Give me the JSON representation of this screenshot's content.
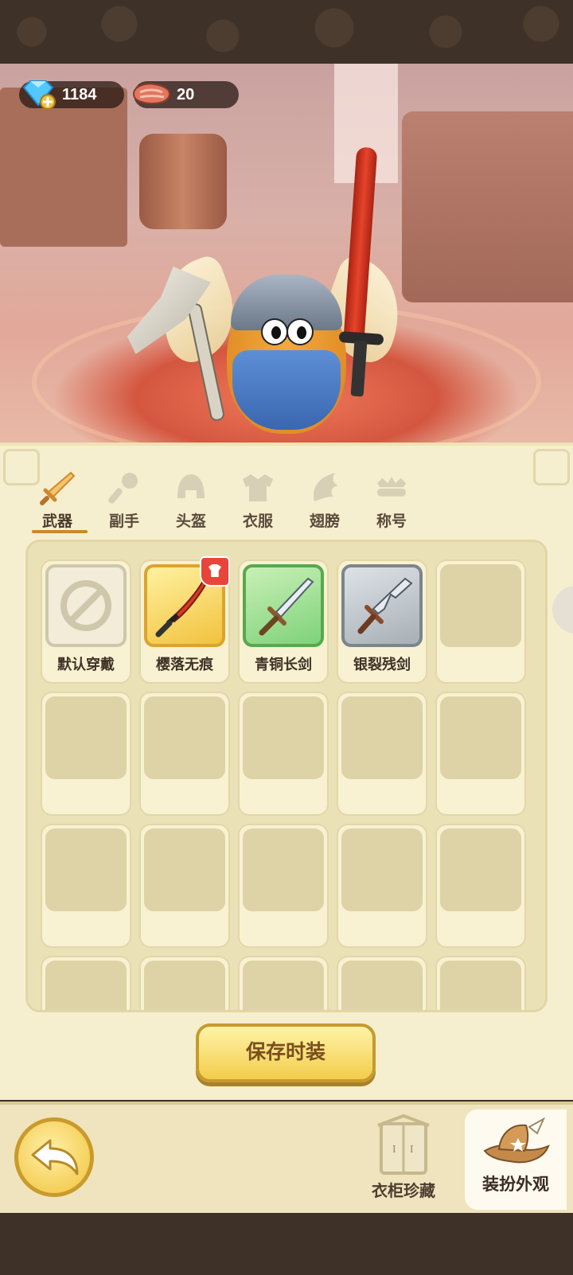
{
  "currency": {
    "gems": "1184",
    "meat": "20",
    "gem_icon": "gem-plus-icon",
    "meat_icon": "meat-icon"
  },
  "tabs": [
    {
      "label": "武器",
      "icon": "sword-icon",
      "active": true
    },
    {
      "label": "副手",
      "icon": "mace-icon",
      "active": false
    },
    {
      "label": "头盔",
      "icon": "helmet-icon",
      "active": false
    },
    {
      "label": "衣服",
      "icon": "armor-icon",
      "active": false
    },
    {
      "label": "翅膀",
      "icon": "wing-icon",
      "active": false
    },
    {
      "label": "称号",
      "icon": "crown-icon",
      "active": false
    }
  ],
  "items": [
    {
      "name": "默认穿戴",
      "rarity": "default"
    },
    {
      "name": "樱落无痕",
      "rarity": "gold",
      "badge": "outfit-badge-icon"
    },
    {
      "name": "青铜长剑",
      "rarity": "green"
    },
    {
      "name": "银裂残剑",
      "rarity": "silver"
    }
  ],
  "buttons": {
    "save": "保存时装",
    "wardrobe": "衣柜珍藏",
    "dress_up": "装扮外观"
  },
  "colors": {
    "accent_gold": "#f3cd4b",
    "panel_bg": "#f6efcf",
    "tab_underline": "#c9892a",
    "rarity_gold": "#dca42d",
    "rarity_green": "#58a84e",
    "rarity_silver": "#7d858c",
    "badge_red": "#e8453a"
  }
}
